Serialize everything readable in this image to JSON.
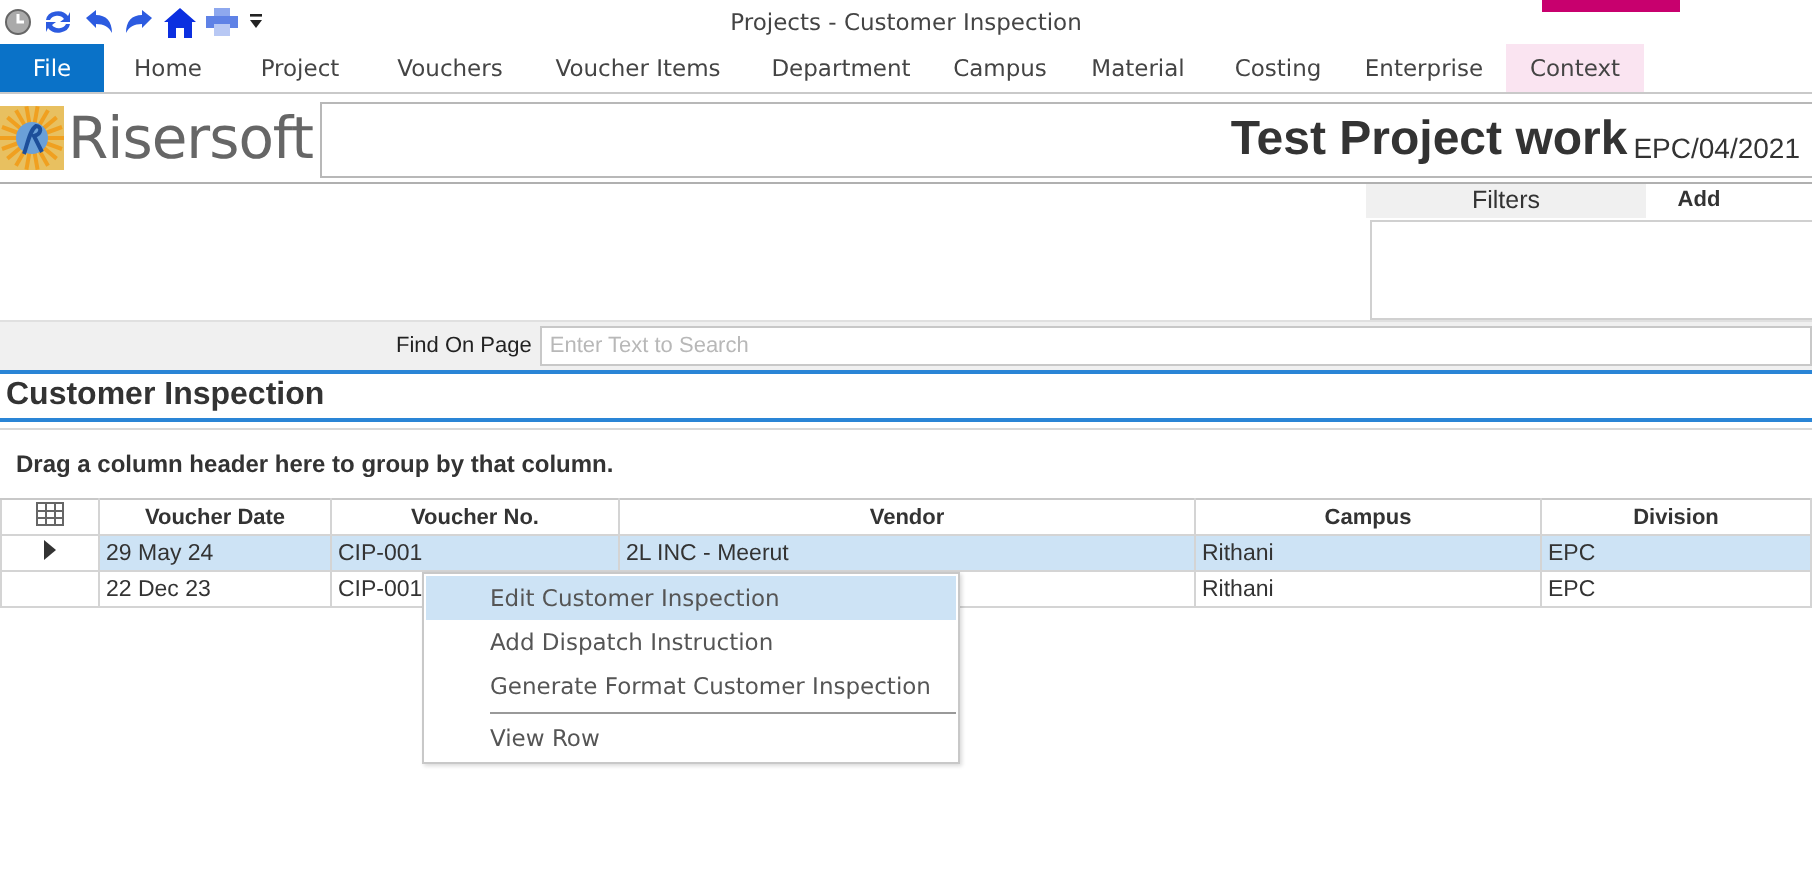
{
  "window": {
    "title": "Projects - Customer Inspection"
  },
  "ribbon_tabs": [
    {
      "label": "File",
      "kind": "file",
      "selected": false
    },
    {
      "label": "Home",
      "kind": "tab",
      "selected": false
    },
    {
      "label": "Project",
      "kind": "tab",
      "selected": false
    },
    {
      "label": "Vouchers",
      "kind": "tab",
      "selected": false
    },
    {
      "label": "Voucher Items",
      "kind": "tab",
      "selected": false
    },
    {
      "label": "Department",
      "kind": "tab",
      "selected": false
    },
    {
      "label": "Campus",
      "kind": "tab",
      "selected": false
    },
    {
      "label": "Material",
      "kind": "tab",
      "selected": false
    },
    {
      "label": "Costing",
      "kind": "tab",
      "selected": false
    },
    {
      "label": "Enterprise",
      "kind": "tab",
      "selected": false
    },
    {
      "label": "Context",
      "kind": "context",
      "selected": false
    }
  ],
  "header": {
    "logo_text": "Risersoft",
    "project_title": "Test Project work",
    "project_code": "EPC/04/2021"
  },
  "filters": {
    "title": "Filters",
    "add_label": "Add"
  },
  "find": {
    "label": "Find On Page",
    "placeholder": "Enter Text to Search"
  },
  "section_title": "Customer Inspection",
  "group_hint": "Drag a column header here to group by that column.",
  "table": {
    "columns": [
      "Voucher Date",
      "Voucher No.",
      "Vendor",
      "Campus",
      "Division"
    ],
    "rows": [
      {
        "current": true,
        "selected": true,
        "cells": [
          "29 May 24",
          "CIP-001",
          "2L INC - Meerut",
          "Rithani",
          "EPC"
        ]
      },
      {
        "current": false,
        "selected": false,
        "cells": [
          "22 Dec 23",
          "CIP-001",
          "",
          "Rithani",
          "EPC"
        ]
      }
    ]
  },
  "context_menu": {
    "items": [
      {
        "label": "Edit Customer Inspection",
        "selected": true,
        "separator_before": false
      },
      {
        "label": "Add Dispatch Instruction",
        "selected": false,
        "separator_before": false
      },
      {
        "label": "Generate Format Customer Inspection",
        "selected": false,
        "separator_before": false
      },
      {
        "label": "View Row",
        "selected": false,
        "separator_before": true
      }
    ]
  }
}
